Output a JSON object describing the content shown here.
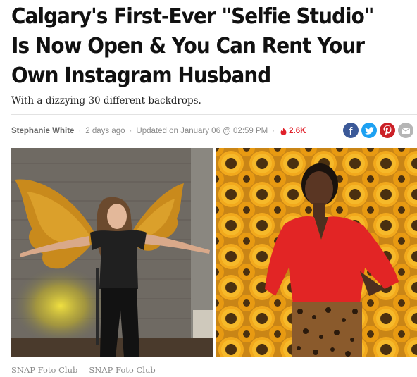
{
  "article": {
    "headline": "Calgary's First-Ever \"Selfie Studio\" Is Now Open & You Can Rent Your Own Instagram Husband",
    "subtitle": "With a dizzying 30 different backdrops."
  },
  "byline": {
    "author": "Stephanie White",
    "posted": "2 days ago",
    "updated": "Updated on January 06 @ 02:59 PM",
    "views": "2.6K",
    "views_icon": "fire-icon",
    "views_color": "#e0202a"
  },
  "share": [
    {
      "name": "facebook-icon",
      "glyph": "f",
      "color": "#3b5998"
    },
    {
      "name": "twitter-icon",
      "glyph": "t",
      "color": "#1da1f2"
    },
    {
      "name": "pinterest-icon",
      "glyph": "p",
      "color": "#cb2027"
    },
    {
      "name": "email-icon",
      "glyph": "✉",
      "color": "#b5b5b5"
    }
  ],
  "photos": [
    {
      "caption": "SNAP Foto Club",
      "description": "photo-woman-gold-wings"
    },
    {
      "caption": "SNAP Foto Club",
      "description": "photo-woman-sunflowers"
    }
  ]
}
